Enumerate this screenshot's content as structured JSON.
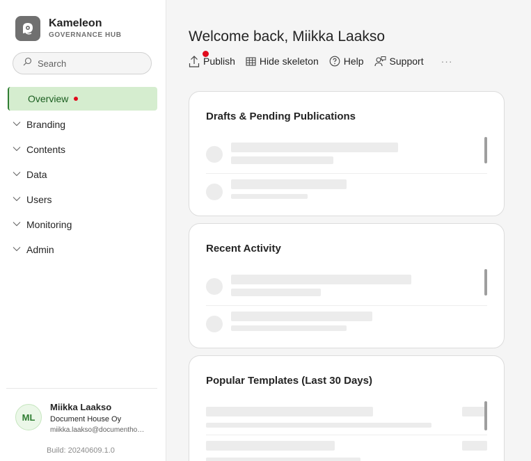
{
  "brand": {
    "name": "Kameleon",
    "subtitle": "GOVERNANCE HUB"
  },
  "search": {
    "placeholder": "Search"
  },
  "nav": {
    "items": [
      {
        "label": "Overview"
      },
      {
        "label": "Branding"
      },
      {
        "label": "Contents"
      },
      {
        "label": "Data"
      },
      {
        "label": "Users"
      },
      {
        "label": "Monitoring"
      },
      {
        "label": "Admin"
      }
    ]
  },
  "user": {
    "initials": "ML",
    "name": "Miikka Laakso",
    "org": "Document House Oy",
    "email": "miikka.laakso@documenthouse.fi"
  },
  "build": "Build: 20240609.1.0",
  "main": {
    "title": "Welcome back, Miikka Laakso",
    "toolbar": {
      "publish": "Publish",
      "hide_skeleton": "Hide skeleton",
      "help": "Help",
      "support": "Support",
      "more": "···"
    },
    "cards": [
      {
        "title": "Drafts & Pending Publications"
      },
      {
        "title": "Recent Activity"
      },
      {
        "title": "Popular Templates (Last 30 Days)"
      }
    ]
  },
  "colors": {
    "accent": "#2f7d32",
    "active_bg": "#d5edcf",
    "notification": "#e00b1c"
  }
}
